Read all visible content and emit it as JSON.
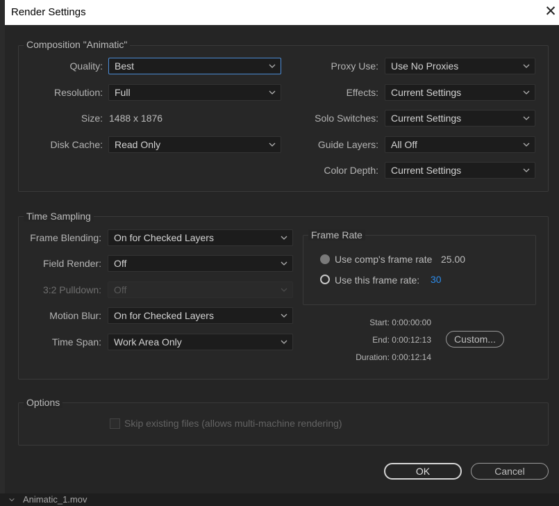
{
  "window": {
    "title": "Render Settings",
    "close_glyph": "✕"
  },
  "composition": {
    "legend": "Composition \"Animatic\"",
    "quality": {
      "label": "Quality:",
      "value": "Best"
    },
    "resolution": {
      "label": "Resolution:",
      "value": "Full"
    },
    "size": {
      "label": "Size:",
      "value": "1488 x 1876"
    },
    "disk_cache": {
      "label": "Disk Cache:",
      "value": "Read Only"
    },
    "proxy_use": {
      "label": "Proxy Use:",
      "value": "Use No Proxies"
    },
    "effects": {
      "label": "Effects:",
      "value": "Current Settings"
    },
    "solo_switches": {
      "label": "Solo Switches:",
      "value": "Current Settings"
    },
    "guide_layers": {
      "label": "Guide Layers:",
      "value": "All Off"
    },
    "color_depth": {
      "label": "Color Depth:",
      "value": "Current Settings"
    }
  },
  "time_sampling": {
    "legend": "Time Sampling",
    "frame_blending": {
      "label": "Frame Blending:",
      "value": "On for Checked Layers"
    },
    "field_render": {
      "label": "Field Render:",
      "value": "Off"
    },
    "pulldown": {
      "label": "3:2 Pulldown:",
      "value": "Off"
    },
    "motion_blur": {
      "label": "Motion Blur:",
      "value": "On for Checked Layers"
    },
    "time_span": {
      "label": "Time Span:",
      "value": "Work Area Only"
    },
    "frame_rate": {
      "legend": "Frame Rate",
      "use_comp_label": "Use comp's frame rate",
      "comp_rate": "25.00",
      "use_this_label": "Use this frame rate:",
      "this_rate": "30",
      "selected": "use_this"
    },
    "start": "Start: 0:00:00:00",
    "end": "End: 0:00:12:13",
    "duration": "Duration: 0:00:12:14",
    "custom_button": "Custom..."
  },
  "options": {
    "legend": "Options",
    "skip_existing": {
      "label": "Skip existing files (allows multi-machine rendering)",
      "checked": false,
      "enabled": false
    }
  },
  "buttons": {
    "ok": "OK",
    "cancel": "Cancel"
  },
  "background": {
    "file_label": "Animatic_1.mov"
  },
  "colors": {
    "accent": "#4d8ed8",
    "link_value": "#2d8ceb",
    "panel": "#252525"
  }
}
